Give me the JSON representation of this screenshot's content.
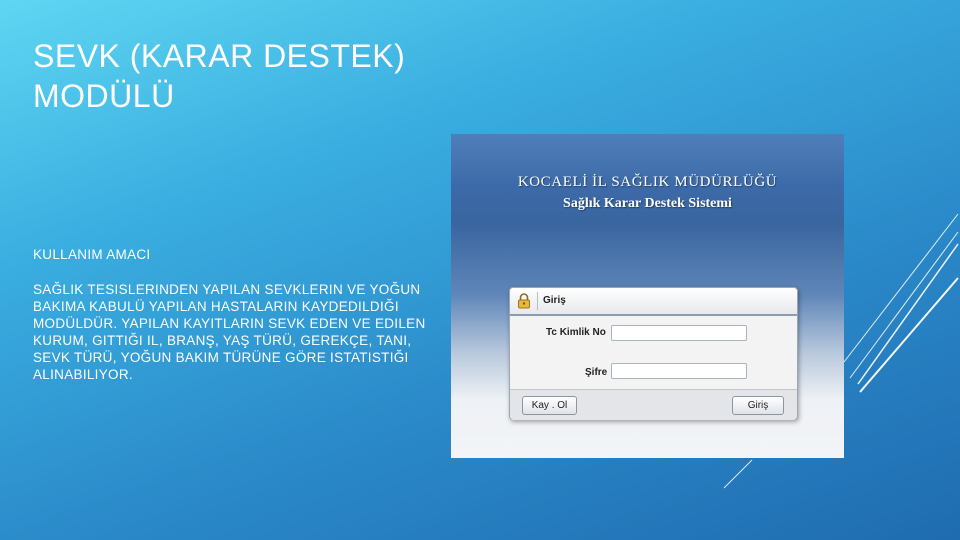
{
  "slide": {
    "title_line1": "SEVK (KARAR DESTEK)",
    "title_line2": "MODÜLÜ",
    "section_heading": "KULLANIM  AMACI",
    "section_text": "SAĞLIK TESISLERINDEN YAPILAN SEVKLERIN VE YOĞUN BAKIMA KABULÜ YAPILAN HASTALARIN KAYDEDILDIĞI MODÜLDÜR. YAPILAN KAYITLARIN SEVK EDEN VE EDILEN KURUM, GITTIĞI IL, BRANŞ, YAŞ TÜRÜ, GEREKÇE, TANI, SEVK TÜRÜ, YOĞUN BAKIM TÜRÜNE GÖRE ISTATISTIĞI ALINABILIYOR."
  },
  "app": {
    "banner_title": "KOCAELİ İL SAĞLIK MÜDÜRLÜĞÜ",
    "banner_subtitle": "Sağlık Karar Destek Sistemi",
    "login": {
      "title": "Giriş",
      "tc_label": "Tc Kimlik No",
      "tc_value": "",
      "password_label": "Şifre",
      "password_value": "",
      "left_button_label": "Kay . Ol",
      "login_button_label": "Giriş"
    }
  },
  "colors": {
    "background_top": "#5fd6f2",
    "background_bottom": "#1f6cb0",
    "banner_blue": "#3c6aa8"
  },
  "icons": [
    "lock-icon"
  ]
}
